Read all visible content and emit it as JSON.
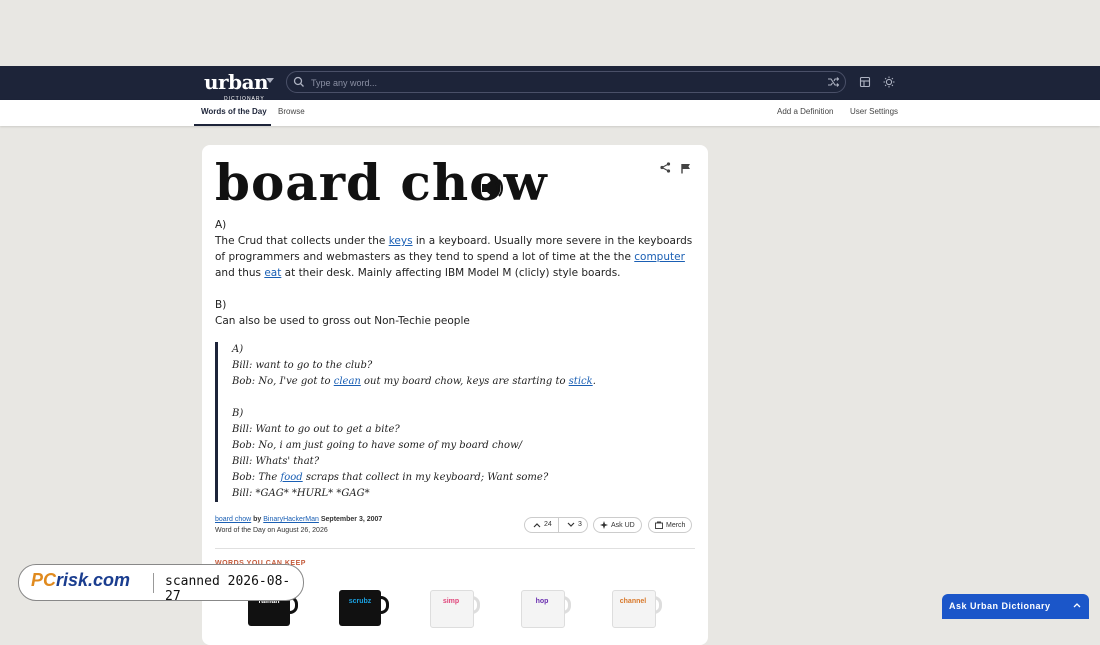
{
  "header": {
    "logo_text": "urban",
    "logo_subtext": "DICTIONARY",
    "search_placeholder": "Type any word..."
  },
  "nav": {
    "items": [
      {
        "label": "Words of the Day",
        "active": true
      },
      {
        "label": "Browse",
        "active": false
      }
    ],
    "right_items": [
      {
        "label": "Add a Definition"
      },
      {
        "label": "User Settings"
      }
    ]
  },
  "entry": {
    "word": "board chow",
    "meaning": {
      "a_label": "A)",
      "a_text_1": "The Crud that collects under the ",
      "a_link_1": "keys",
      "a_text_2": " in a keyboard. Usually more severe in the keyboards of programmers and webmasters as they tend to spend a lot of time at the the ",
      "a_link_2": "computer",
      "a_text_3": " and thus ",
      "a_link_3": "eat",
      "a_text_4": " at their desk. Mainly affecting IBM Model M (clicly) style boards.",
      "b_label": "B)",
      "b_text": "Can also be used to gross out Non-Techie people"
    },
    "example": {
      "a_label": "A)",
      "line1": "Bill: want to go to the club?",
      "line2_pre": "Bob: No, I've got to ",
      "line2_link": "clean",
      "line2_mid": " out my board chow, keys are starting to ",
      "line2_link2": "stick",
      "line2_post": ".",
      "b_label": "B)",
      "line3": "Bill: Want to go out to get a bite?",
      "line4": "Bob: No, i am just going to have some of my board chow/",
      "line5": "Bill: Whats' that?",
      "line6_pre": "Bob: The ",
      "line6_link": "food",
      "line6_post": " scraps that collect in my keyboard; Want some?",
      "line7": "Bill: *GAG* *HURL* *GAG*"
    },
    "contributor": {
      "word_link": "board chow",
      "by": " by ",
      "author": "BinaryHackerMan",
      "date": " September 3, 2007",
      "wotd": "Word of the Day on August 26, 2026"
    },
    "votes": {
      "up": "24",
      "down": "3"
    },
    "ask_ud_label": "Ask UD",
    "merch_label": "Merch"
  },
  "merch": {
    "title": "WORDS YOU CAN KEEP",
    "items": [
      {
        "label": "railfan",
        "mug_color": "#111111",
        "text_color": "#ffffff"
      },
      {
        "label": "scrubz",
        "mug_color": "#111111",
        "text_color": "#1aa0e0"
      },
      {
        "label": "simp",
        "mug_color": "#f4f4f4",
        "text_color": "#e0457a"
      },
      {
        "label": "hop",
        "mug_color": "#f4f4f4",
        "text_color": "#6a2fb0"
      },
      {
        "label": "channel",
        "mug_color": "#f4f4f4",
        "text_color": "#d8782a"
      }
    ]
  },
  "watermark": {
    "logo_a": "PC",
    "logo_b": "risk.com",
    "text": "scanned 2026-08-27"
  },
  "ask_bar": {
    "label": "Ask Urban Dictionary"
  },
  "colors": {
    "header_bg": "#1d2439",
    "link": "#1a5fb4",
    "ask_bar": "#1b56c9"
  }
}
